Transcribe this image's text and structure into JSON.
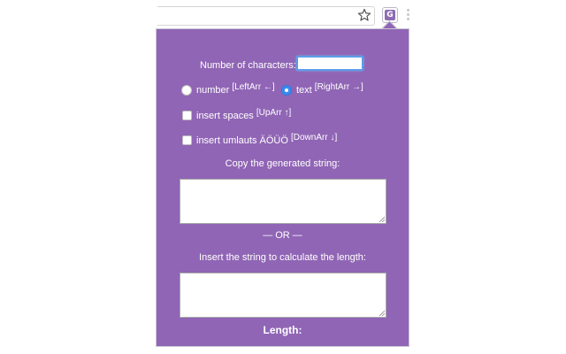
{
  "browser": {
    "star_icon": "star-icon",
    "extension_icon": {
      "name": "extension-icon",
      "letter": "G",
      "color": "#8e6bb4"
    },
    "menu_icon": "kebab-menu-icon"
  },
  "popup": {
    "background": "#9065b5",
    "num_chars_label": "Number of characters:",
    "num_chars_value": "",
    "type_options": [
      {
        "label": "number",
        "hint": "[LeftArr ←]",
        "checked": false
      },
      {
        "label": "text",
        "hint": "[RightArr →]",
        "checked": true
      }
    ],
    "insert_spaces": {
      "label": "insert spaces",
      "hint": "[UpArr ↑]",
      "checked": false
    },
    "insert_umlauts": {
      "label": "insert umlauts ÄÖÜÖ",
      "hint": "[DownArr ↓]",
      "checked": false
    },
    "copy_label": "Copy the generated string:",
    "or_divider": "— OR —",
    "insert_label": "Insert the string to calculate the length:",
    "length_label": "Length:"
  }
}
